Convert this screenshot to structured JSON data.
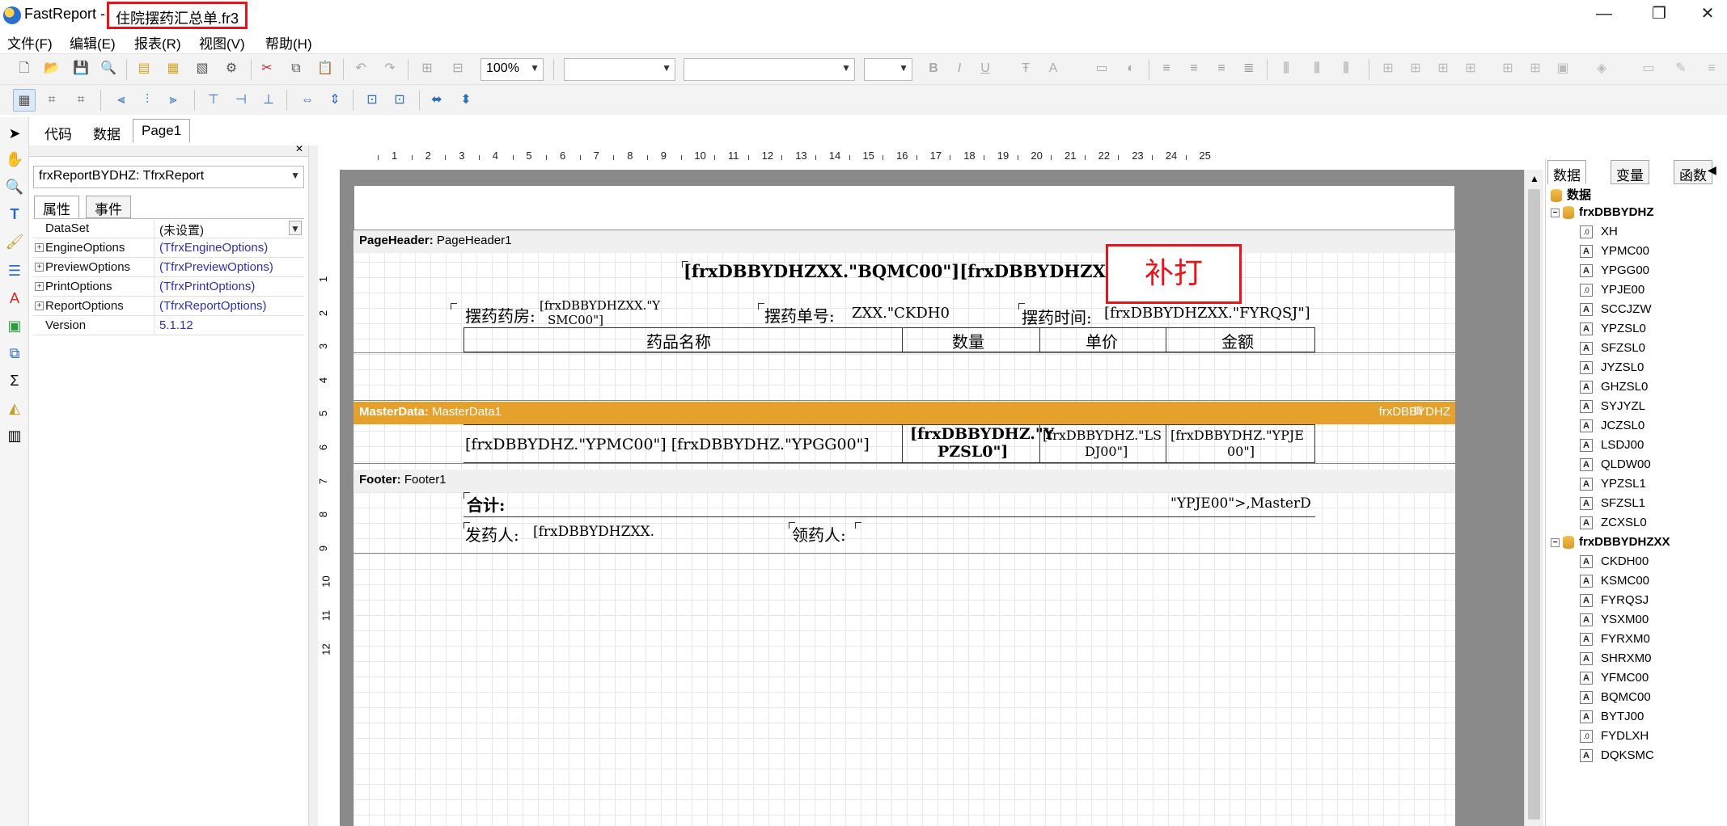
{
  "window": {
    "app_name": "FastReport -",
    "file_name": "住院摆药汇总单.fr3",
    "controls": [
      "—",
      "❐",
      "✕"
    ]
  },
  "menu": [
    "文件(F)",
    "编辑(E)",
    "报表(R)",
    "视图(V)",
    "帮助(H)"
  ],
  "toolbar": {
    "zoom": "100%"
  },
  "view_tabs": [
    "代码",
    "数据",
    "Page1"
  ],
  "inspector": {
    "object_combo": "frxReportBYDHZ: TfrxReport",
    "tabs": [
      "属性",
      "事件"
    ],
    "properties": [
      {
        "name": "DataSet",
        "value": "(未设置)",
        "expandable": false,
        "plain": true,
        "combo": true
      },
      {
        "name": "EngineOptions",
        "value": "(TfrxEngineOptions)",
        "expandable": true
      },
      {
        "name": "PreviewOptions",
        "value": "(TfrxPreviewOptions)",
        "expandable": true
      },
      {
        "name": "PrintOptions",
        "value": "(TfrxPrintOptions)",
        "expandable": true
      },
      {
        "name": "ReportOptions",
        "value": "(TfrxReportOptions)",
        "expandable": true
      },
      {
        "name": "Version",
        "value": "5.1.12",
        "expandable": false
      }
    ]
  },
  "ruler": {
    "h": [
      "1",
      "2",
      "3",
      "4",
      "5",
      "6",
      "7",
      "8",
      "9",
      "10",
      "11",
      "12",
      "13",
      "14",
      "15",
      "16",
      "17",
      "18",
      "19",
      "20",
      "21",
      "22",
      "23",
      "24",
      "25"
    ],
    "v": [
      "1",
      "2",
      "3",
      "4",
      "5",
      "6",
      "7",
      "8",
      "9",
      "10",
      "11",
      "12"
    ]
  },
  "report": {
    "page_header": {
      "band_type": "PageHeader:",
      "band_name": "PageHeader1"
    },
    "title_field": "[frxDBBYDHZXX.\"BQMC00\"][frxDBBYDHZXX.\"BY",
    "pharmacy_label": "摆药药房:",
    "pharmacy_field": "[frxDBBYDHZXX.\"Y",
    "pharmacy_field_2": "SMC00\"]",
    "order_label": "摆药单号:",
    "order_field": "ZXX.\"CKDH0",
    "time_label": "摆药时间:",
    "time_field": "[frxDBBYDHZXX.\"FYRQSJ\"]",
    "col_headers": [
      "药品名称",
      "数量",
      "单价",
      "金额"
    ],
    "master_data": {
      "band_type": "MasterData:",
      "band_name": "MasterData1",
      "dataset": "frxDBBYDHZ"
    },
    "row_name": "[frxDBBYDHZ.\"YPMC00\"] [frxDBBYDHZ.\"YPGG00\"]",
    "row_qty_1": "[frxDBBYDHZ.\"Y",
    "row_qty_2": "PZSL0\"]",
    "row_price_1": "[frxDBBYDHZ.\"LS",
    "row_price_2": "DJ00\"]",
    "row_amount_1": "[frxDBBYDHZ.\"YPJE",
    "row_amount_2": "00\"]",
    "footer": {
      "band_type": "Footer:",
      "band_name": "Footer1"
    },
    "total_label": "合计:",
    "total_field": "\"YPJE00\">,MasterD",
    "dispenser_label": "发药人:",
    "dispenser_field": "[frxDBBYDHZXX.",
    "receiver_label": "领药人:",
    "reprint_label": "补打"
  },
  "data_panel": {
    "tabs": [
      "数据",
      "变量",
      "函数"
    ],
    "root": "数据",
    "datasets": [
      {
        "name": "frxDBBYDHZ",
        "fields": [
          {
            "name": "XH",
            "type": "n"
          },
          {
            "name": "YPMC00",
            "type": "a"
          },
          {
            "name": "YPGG00",
            "type": "a"
          },
          {
            "name": "YPJE00",
            "type": "n"
          },
          {
            "name": "SCCJZW",
            "type": "a"
          },
          {
            "name": "YPZSL0",
            "type": "a"
          },
          {
            "name": "SFZSL0",
            "type": "a"
          },
          {
            "name": "JYZSL0",
            "type": "a"
          },
          {
            "name": "GHZSL0",
            "type": "a"
          },
          {
            "name": "SYJYZL",
            "type": "a"
          },
          {
            "name": "JCZSL0",
            "type": "a"
          },
          {
            "name": "LSDJ00",
            "type": "a"
          },
          {
            "name": "QLDW00",
            "type": "a"
          },
          {
            "name": "YPZSL1",
            "type": "a"
          },
          {
            "name": "SFZSL1",
            "type": "a"
          },
          {
            "name": "ZCXSL0",
            "type": "a"
          }
        ]
      },
      {
        "name": "frxDBBYDHZXX",
        "fields": [
          {
            "name": "CKDH00",
            "type": "a"
          },
          {
            "name": "KSMC00",
            "type": "a"
          },
          {
            "name": "FYRQSJ",
            "type": "a"
          },
          {
            "name": "YSXM00",
            "type": "a"
          },
          {
            "name": "FYRXM0",
            "type": "a"
          },
          {
            "name": "SHRXM0",
            "type": "a"
          },
          {
            "name": "YFMC00",
            "type": "a"
          },
          {
            "name": "BQMC00",
            "type": "a"
          },
          {
            "name": "BYTJ00",
            "type": "a"
          },
          {
            "name": "FYDLXH",
            "type": "n"
          },
          {
            "name": "DQKSMC",
            "type": "a"
          }
        ]
      }
    ]
  },
  "colors": {
    "master_band": "#e6a12c",
    "highlight": "#e8141b",
    "field_link": "#2f2fb8"
  }
}
